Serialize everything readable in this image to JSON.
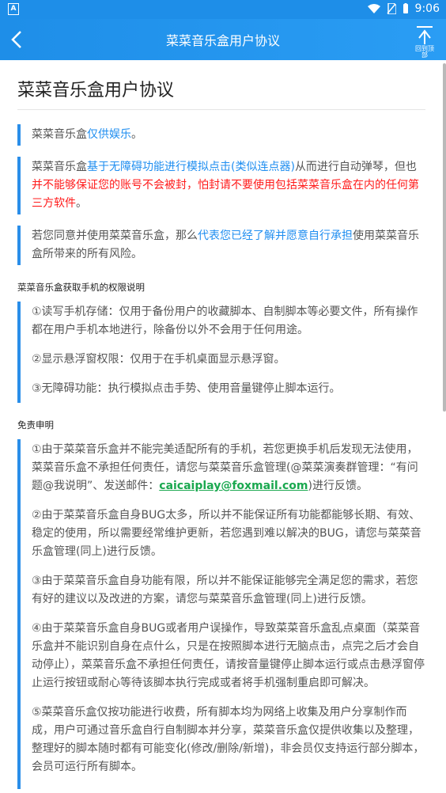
{
  "status": {
    "time": "9:06",
    "left_badge": "A"
  },
  "appbar": {
    "title": "菜菜音乐盒用户协议",
    "to_top_label": "回到顶部"
  },
  "page": {
    "heading": "菜菜音乐盒用户协议",
    "notes": [
      {
        "parts": [
          {
            "text": "菜菜音乐盒",
            "style": "normal"
          },
          {
            "text": "仅供娱乐",
            "style": "blue"
          },
          {
            "text": "。",
            "style": "normal"
          }
        ]
      },
      {
        "parts": [
          {
            "text": "菜菜音乐盒",
            "style": "normal"
          },
          {
            "text": "基于无障碍功能进行模拟点击(类似连点器)",
            "style": "blue"
          },
          {
            "text": "从而进行自动弹琴，但也",
            "style": "normal"
          },
          {
            "text": "并不能够保证您的账号不会被封，怕封请不要使用包括菜菜音乐盒在内的任何第三方软件",
            "style": "red"
          },
          {
            "text": "。",
            "style": "normal"
          }
        ]
      },
      {
        "parts": [
          {
            "text": "若您同意并使用菜菜音乐盒，那么",
            "style": "normal"
          },
          {
            "text": "代表您已经了解并愿意自行承担",
            "style": "blue"
          },
          {
            "text": "使用菜菜音乐盒所带来的所有风险。",
            "style": "normal"
          }
        ]
      }
    ],
    "permissions_title": "菜菜音乐盒获取手机的权限说明",
    "permissions": [
      "①读写手机存储：仅用于备份用户的收藏脚本、自制脚本等必要文件，所有操作都在用户手机本地进行，除备份以外不会用于任何用途。",
      "②显示悬浮窗权限：仅用于在手机桌面显示悬浮窗。",
      "③无障碍功能：执行模拟点击手势、使用音量键停止脚本运行。"
    ],
    "disclaimer_title": "免责申明",
    "disclaimer_first_prefix": "①由于菜菜音乐盒并不能完美适配所有的手机，若您更换手机后发现无法使用，菜菜音乐盒不承担任何责任，请您与菜菜音乐盒管理(@菜菜演奏群管理：“有问题@我说明”、发送邮件：",
    "disclaimer_email": "caicaiplay@foxmail.com",
    "disclaimer_first_suffix": ")进行反馈。",
    "disclaimers": [
      "②由于菜菜音乐盒自身BUG太多，所以并不能保证所有功能都能够长期、有效、稳定的使用，所以需要经常维护更新，若您遇到难以解决的BUG，请您与菜菜音乐盒管理(同上)进行反馈。",
      "③由于菜菜音乐盒自身功能有限，所以并不能保证能够完全满足您的需求，若您有好的建议以及改进的方案，请您与菜菜音乐盒管理(同上)进行反馈。",
      "④由于菜菜音乐盒自身BUG或者用户误操作，导致菜菜音乐盒乱点桌面（菜菜音乐盒并不能识别自身在点什么，只是在按照脚本进行无脑点击，点完之后才会自动停止），菜菜音乐盒不承担任何责任，请按音量键停止脚本运行或点击悬浮窗停止运行按钮或耐心等待该脚本执行完成或者将手机强制重启即可解决。",
      "⑤菜菜音乐盒仅按功能进行收费，所有脚本均为网络上收集及用户分享制作而成，用户可通过音乐盒自行自制脚本并分享，菜菜音乐盒仅提供收集以及整理，整理好的脚本随时都有可能变化(修改/删除/新增)，非会员仅支持运行部分脚本，会员可运行所有脚本。"
    ]
  }
}
